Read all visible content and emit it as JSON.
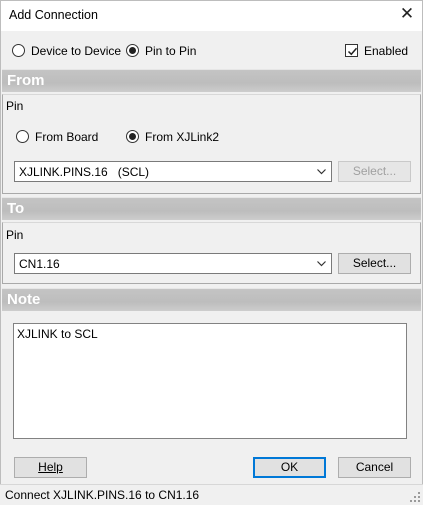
{
  "window": {
    "title": "Add Connection"
  },
  "mode": {
    "device_to_device": "Device to Device",
    "pin_to_pin": "Pin to Pin",
    "enabled": "Enabled"
  },
  "from": {
    "header": "From",
    "group": "Pin",
    "from_board": "From Board",
    "from_xjlink": "From XJLink2",
    "pin_value": "XJLINK.PINS.16   (SCL)",
    "select": "Select..."
  },
  "to": {
    "header": "To",
    "group": "Pin",
    "pin_value": "CN1.16",
    "select": "Select..."
  },
  "note": {
    "header": "Note",
    "text": "XJLINK to SCL"
  },
  "buttons": {
    "help": "Help",
    "ok": "OK",
    "cancel": "Cancel"
  },
  "status": {
    "text": "Connect XJLINK.PINS.16 to CN1.16"
  }
}
